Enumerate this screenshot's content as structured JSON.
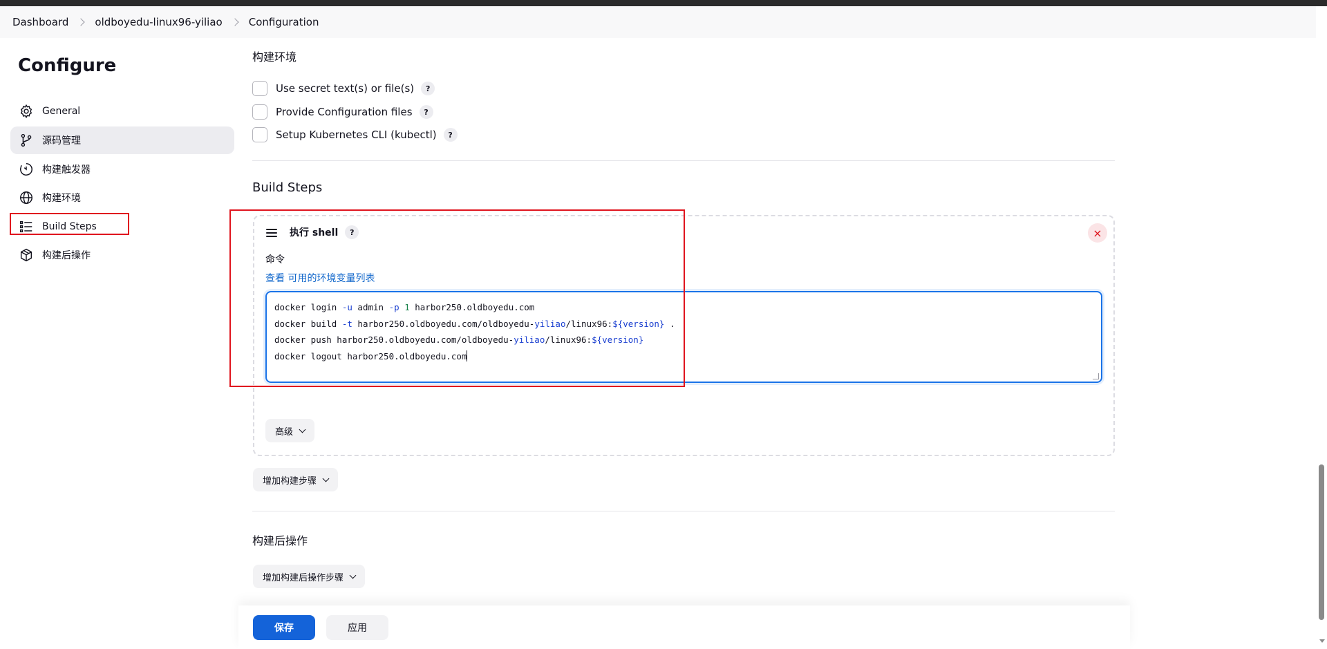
{
  "breadcrumb": {
    "items": [
      "Dashboard",
      "oldboyedu-linux96-yiliao",
      "Configuration"
    ]
  },
  "sidebar": {
    "title": "Configure",
    "items": [
      {
        "label": "General",
        "icon": "gear-icon"
      },
      {
        "label": "源码管理",
        "icon": "branch-icon"
      },
      {
        "label": "构建触发器",
        "icon": "timer-icon"
      },
      {
        "label": "构建环境",
        "icon": "globe-icon"
      },
      {
        "label": "Build Steps",
        "icon": "list-icon"
      },
      {
        "label": "构建后操作",
        "icon": "package-icon"
      }
    ],
    "active_index": 1
  },
  "build_env": {
    "title": "构建环境",
    "options": [
      {
        "label": "Use secret text(s) or file(s)",
        "checked": false
      },
      {
        "label": "Provide Configuration files",
        "checked": false
      },
      {
        "label": "Setup Kubernetes CLI (kubectl)",
        "checked": false
      }
    ],
    "help": "?"
  },
  "build_steps": {
    "title": "Build Steps",
    "step": {
      "title": "执行 shell",
      "command_label": "命令",
      "env_prefix": "查看",
      "env_link": "可用的环境变量列表",
      "command_lines": [
        "docker login -u admin -p 1 harbor250.oldboyedu.com",
        "docker build -t harbor250.oldboyedu.com/oldboyedu-yiliao/linux96:${version} .",
        "docker push harbor250.oldboyedu.com/oldboyedu-yiliao/linux96:${version}",
        "docker logout harbor250.oldboyedu.com"
      ],
      "advanced_label": "高级",
      "close_symbol": "×"
    },
    "add_step_label": "增加构建步骤"
  },
  "post_build": {
    "title": "构建后操作",
    "add_label": "增加构建后操作步骤"
  },
  "footer": {
    "save_label": "保存",
    "apply_label": "应用"
  },
  "colors": {
    "accent": "#1463d9",
    "highlight_box": "#e0141e",
    "link": "#1469cc"
  }
}
